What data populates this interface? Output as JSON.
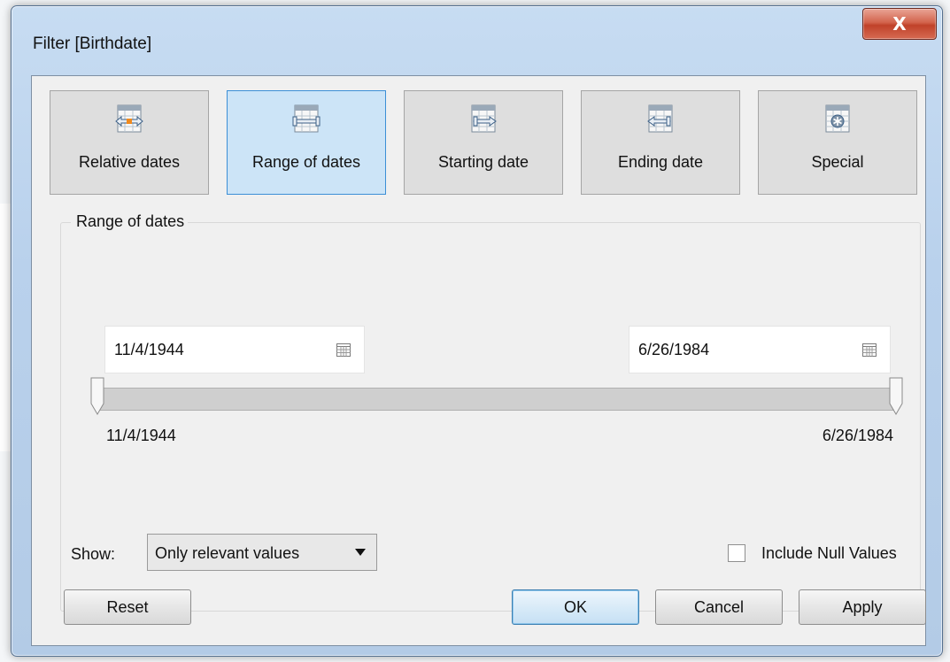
{
  "window": {
    "title": "Filter [Birthdate]",
    "close_label": "X"
  },
  "modes": [
    {
      "label": "Relative dates",
      "icon": "relative-dates-icon",
      "selected": false
    },
    {
      "label": "Range of dates",
      "icon": "range-of-dates-icon",
      "selected": true
    },
    {
      "label": "Starting date",
      "icon": "starting-date-icon",
      "selected": false
    },
    {
      "label": "Ending date",
      "icon": "ending-date-icon",
      "selected": false
    },
    {
      "label": "Special",
      "icon": "special-icon",
      "selected": false
    }
  ],
  "range": {
    "group_title": "Range of dates",
    "start_value": "11/4/1944",
    "end_value": "6/26/1984",
    "slider_min_label": "11/4/1944",
    "slider_max_label": "6/26/1984"
  },
  "show": {
    "label": "Show:",
    "selected": "Only relevant values"
  },
  "include_null": {
    "label": "Include Null Values",
    "checked": false
  },
  "buttons": {
    "reset": "Reset",
    "ok": "OK",
    "cancel": "Cancel",
    "apply": "Apply"
  },
  "colors": {
    "selected_mode_bg": "#cce4f7",
    "selected_mode_border": "#3c8fd6",
    "close_button": "#c0422a"
  }
}
